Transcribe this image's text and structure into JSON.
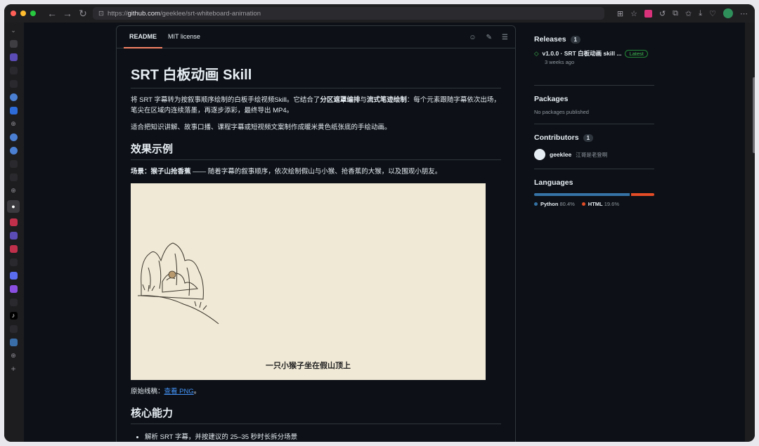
{
  "browser": {
    "url_prefix": "https://",
    "url_host": "github.com",
    "url_path": "/geeklee/srt-whiteboard-animation"
  },
  "readme": {
    "tabs": [
      "README",
      "MIT license"
    ],
    "title": "SRT 白板动画 Skill",
    "intro_1_a": "将 SRT 字幕转为按叙事顺序绘制的白板手绘视频Skill。它结合了",
    "intro_1_b": "分区遮罩编排",
    "intro_1_c": "与",
    "intro_1_d": "流式笔迹绘制",
    "intro_1_e": "：每个元素跟随字幕依次出场，笔尖在区域内连续落墨，再逐步添彩，最终导出 MP4。",
    "intro_2": "适合把知识讲解、故事口播、课程字幕或短视频文案制作成暖米黄色纸张底的手绘动画。",
    "h2_examples": "效果示例",
    "scene_label": "场景：猴子山抢香蕉",
    "scene_text": " —— 随着字幕的叙事顺序，依次绘制假山与小猴、抢香蕉的大猴，以及围观小朋友。",
    "figure_subtitle": "一只小猴子坐在假山顶上",
    "sketch_text": "原始线稿：",
    "sketch_link": "查看 PNG",
    "sketch_end": "。",
    "h2_core": "核心能力",
    "bullet_1": "解析 SRT 字幕，并按建议的 25–35 秒时长拆分场景"
  },
  "sidebar": {
    "releases_title": "Releases",
    "releases_count": "1",
    "release_name": "v1.0.0 · SRT 白板动画 skill ...",
    "release_badge": "Latest",
    "release_time": "3 weeks ago",
    "packages_title": "Packages",
    "packages_text": "No packages published",
    "contributors_title": "Contributors",
    "contributors_count": "1",
    "contributor_login": "geeklee",
    "contributor_name": "江哥是老登啊",
    "languages_title": "Languages",
    "languages": [
      {
        "name": "Python",
        "percent": "80.4%",
        "value": 80.4,
        "color": "#3572A5"
      },
      {
        "name": "HTML",
        "percent": "19.6%",
        "value": 19.6,
        "color": "#e34c26"
      }
    ]
  }
}
